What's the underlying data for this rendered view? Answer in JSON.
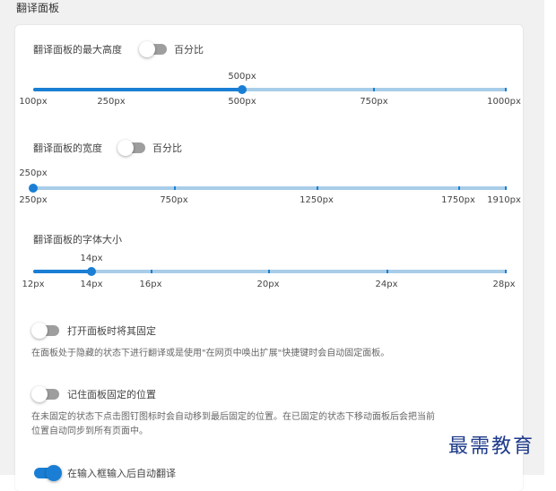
{
  "section_title": "翻译面板",
  "max_height": {
    "label": "翻译面板的最大高度",
    "toggle_label": "百分比",
    "toggle_on": false,
    "value": "500px",
    "marks": [
      "100px",
      "250px",
      "500px",
      "750px",
      "1000px"
    ]
  },
  "width": {
    "label": "翻译面板的宽度",
    "toggle_label": "百分比",
    "toggle_on": false,
    "value": "250px",
    "marks": [
      "250px",
      "750px",
      "1250px",
      "1750px",
      "1910px"
    ]
  },
  "font_size": {
    "label": "翻译面板的字体大小",
    "value": "14px",
    "marks": [
      "12px",
      "14px",
      "16px",
      "20px",
      "24px",
      "28px"
    ]
  },
  "pin_on_open": {
    "label": "打开面板时将其固定",
    "toggle_on": false,
    "description": "在面板处于隐藏的状态下进行翻译或是使用\"在网页中唤出扩展\"快捷键时会自动固定面板。"
  },
  "remember_position": {
    "label": "记住面板固定的位置",
    "toggle_on": false,
    "description_line1": "在未固定的状态下点击图钉图标时会自动移到最后固定的位置。在已固定的状态下移动面板后会把当前",
    "description_line2": "位置自动同步到所有页面中。"
  },
  "auto_translate": {
    "label": "在输入框输入后自动翻译",
    "toggle_on": true
  },
  "watermark": "最需教育",
  "colors": {
    "accent": "#1a7fd4",
    "track": "#a8cde8"
  }
}
